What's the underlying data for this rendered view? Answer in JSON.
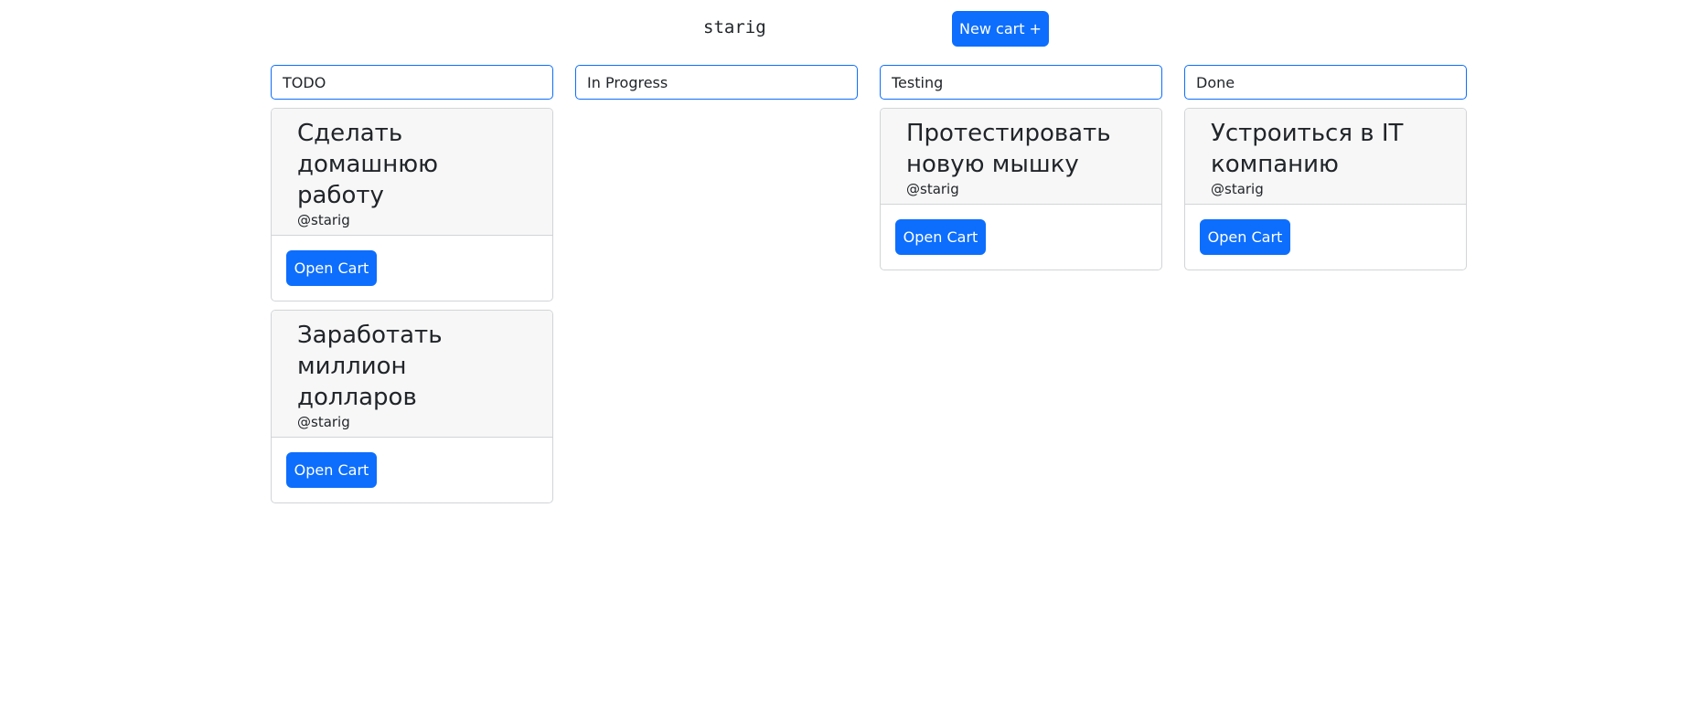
{
  "header": {
    "username": "starig",
    "new_cart_label": "New cart +"
  },
  "columns": [
    {
      "title": "TODO",
      "cards": [
        {
          "title": "Сделать домашнюю работу",
          "author": "@starig",
          "button": "Open Cart"
        },
        {
          "title": "Заработать миллион долларов",
          "author": "@starig",
          "button": "Open Cart"
        }
      ]
    },
    {
      "title": "In Progress",
      "cards": []
    },
    {
      "title": "Testing",
      "cards": [
        {
          "title": "Протестировать новую мышку",
          "author": "@starig",
          "button": "Open Cart"
        }
      ]
    },
    {
      "title": "Done",
      "cards": [
        {
          "title": "Устроиться в IT компанию",
          "author": "@starig",
          "button": "Open Cart"
        }
      ]
    }
  ],
  "colors": {
    "primary": "#0d6efd",
    "card_header_bg": "#f7f7f7",
    "border": "#d2d4d7"
  }
}
